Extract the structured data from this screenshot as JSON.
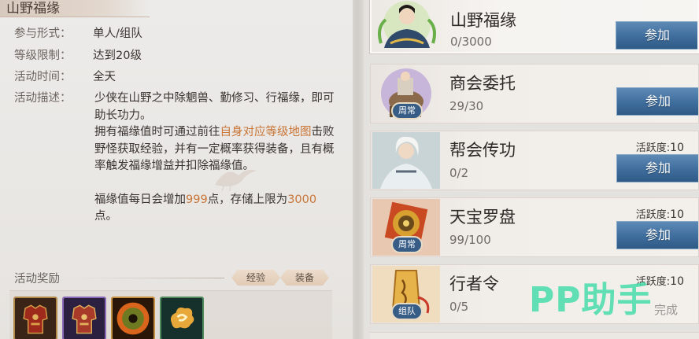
{
  "detail": {
    "title": "山野福缘",
    "rows": [
      {
        "label": "参与形式：",
        "value": "单人/组队"
      },
      {
        "label": "等级限制：",
        "value": "达到20级"
      },
      {
        "label": "活动时间：",
        "value": "全天"
      }
    ],
    "desc_label": "活动描述：",
    "desc_p1": "少侠在山野之中除魍兽、勤修习、行福缘，即可助长功力。",
    "desc_p2_a": "拥有福缘值时可通过前往",
    "desc_p2_hl": "自身对应等级地图",
    "desc_p2_b": "击败野怪获取经验，并有一定概率获得装备，且有概率触发福缘增益并扣除福缘值。",
    "desc_p3_a": "福缘值每日会增加",
    "desc_p3_hl1": "999",
    "desc_p3_b": "点，存储上限为",
    "desc_p3_hl2": "3000",
    "desc_p3_c": "点。",
    "reward_label": "活动奖励",
    "tags": [
      "经验",
      "装备"
    ],
    "reward_icons": [
      "armor-red-icon",
      "armor-purple-icon",
      "jade-disc-icon",
      "cloud-charm-icon"
    ]
  },
  "activities": [
    {
      "name": "山野福缘",
      "progress": "0/3000",
      "badge": "",
      "button": "参加",
      "activity_label": "",
      "activity_value": "",
      "status": "",
      "selected": true
    },
    {
      "name": "商会委托",
      "progress": "29/30",
      "badge": "周常",
      "button": "参加",
      "activity_label": "",
      "activity_value": "",
      "status": ""
    },
    {
      "name": "帮会传功",
      "progress": "0/2",
      "badge": "",
      "button": "参加",
      "activity_label": "活跃度:",
      "activity_value": "10",
      "status": ""
    },
    {
      "name": "天宝罗盘",
      "progress": "99/100",
      "badge": "周常",
      "button": "参加",
      "activity_label": "活跃度:",
      "activity_value": "10",
      "status": ""
    },
    {
      "name": "行者令",
      "progress": "0/5",
      "badge": "组队",
      "button": "",
      "activity_label": "活跃度:",
      "activity_value": "10",
      "status": "完成"
    }
  ],
  "watermark": "PP助手",
  "colors": {
    "highlight": "#c97536",
    "button": "#3f6d9c",
    "badge": "#375d86",
    "watermark": "#46dcaa"
  }
}
